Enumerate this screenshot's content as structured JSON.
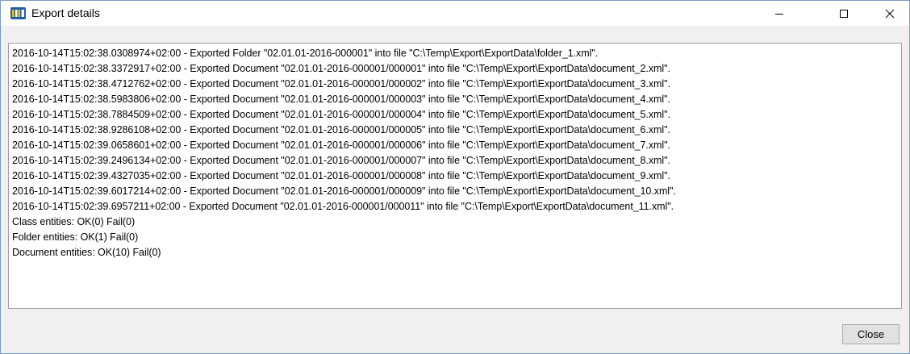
{
  "window": {
    "title": "Export details",
    "icon": "ims-app-icon",
    "caption_buttons": [
      "minimize-icon",
      "maximize-icon",
      "close-icon"
    ]
  },
  "log": {
    "lines": [
      "2016-10-14T15:02:38.0308974+02:00 - Exported Folder \"02.01.01-2016-000001\" into file \"C:\\Temp\\Export\\ExportData\\folder_1.xml\".",
      "2016-10-14T15:02:38.3372917+02:00 - Exported Document \"02.01.01-2016-000001/000001\" into file \"C:\\Temp\\Export\\ExportData\\document_2.xml\".",
      "2016-10-14T15:02:38.4712762+02:00 - Exported Document \"02.01.01-2016-000001/000002\" into file \"C:\\Temp\\Export\\ExportData\\document_3.xml\".",
      "2016-10-14T15:02:38.5983806+02:00 - Exported Document \"02.01.01-2016-000001/000003\" into file \"C:\\Temp\\Export\\ExportData\\document_4.xml\".",
      "2016-10-14T15:02:38.7884509+02:00 - Exported Document \"02.01.01-2016-000001/000004\" into file \"C:\\Temp\\Export\\ExportData\\document_5.xml\".",
      "2016-10-14T15:02:38.9286108+02:00 - Exported Document \"02.01.01-2016-000001/000005\" into file \"C:\\Temp\\Export\\ExportData\\document_6.xml\".",
      "2016-10-14T15:02:39.0658601+02:00 - Exported Document \"02.01.01-2016-000001/000006\" into file \"C:\\Temp\\Export\\ExportData\\document_7.xml\".",
      "2016-10-14T15:02:39.2496134+02:00 - Exported Document \"02.01.01-2016-000001/000007\" into file \"C:\\Temp\\Export\\ExportData\\document_8.xml\".",
      "2016-10-14T15:02:39.4327035+02:00 - Exported Document \"02.01.01-2016-000001/000008\" into file \"C:\\Temp\\Export\\ExportData\\document_9.xml\".",
      "2016-10-14T15:02:39.6017214+02:00 - Exported Document \"02.01.01-2016-000001/000009\" into file \"C:\\Temp\\Export\\ExportData\\document_10.xml\".",
      "2016-10-14T15:02:39.6957211+02:00 - Exported Document \"02.01.01-2016-000001/000011\" into file \"C:\\Temp\\Export\\ExportData\\document_11.xml\".",
      "Class entities: OK(0) Fail(0)",
      "Folder entities: OK(1) Fail(0)",
      "Document entities: OK(10) Fail(0)"
    ]
  },
  "footer": {
    "close_label": "Close"
  },
  "colors": {
    "window_border": "#7a9cc6",
    "dialog_background": "#f0f0f0",
    "log_background": "#ffffff",
    "button_background": "#e1e1e1",
    "button_border": "#adadad",
    "icon_blue": "#1f5fa8",
    "icon_yellow": "#f2c200"
  }
}
